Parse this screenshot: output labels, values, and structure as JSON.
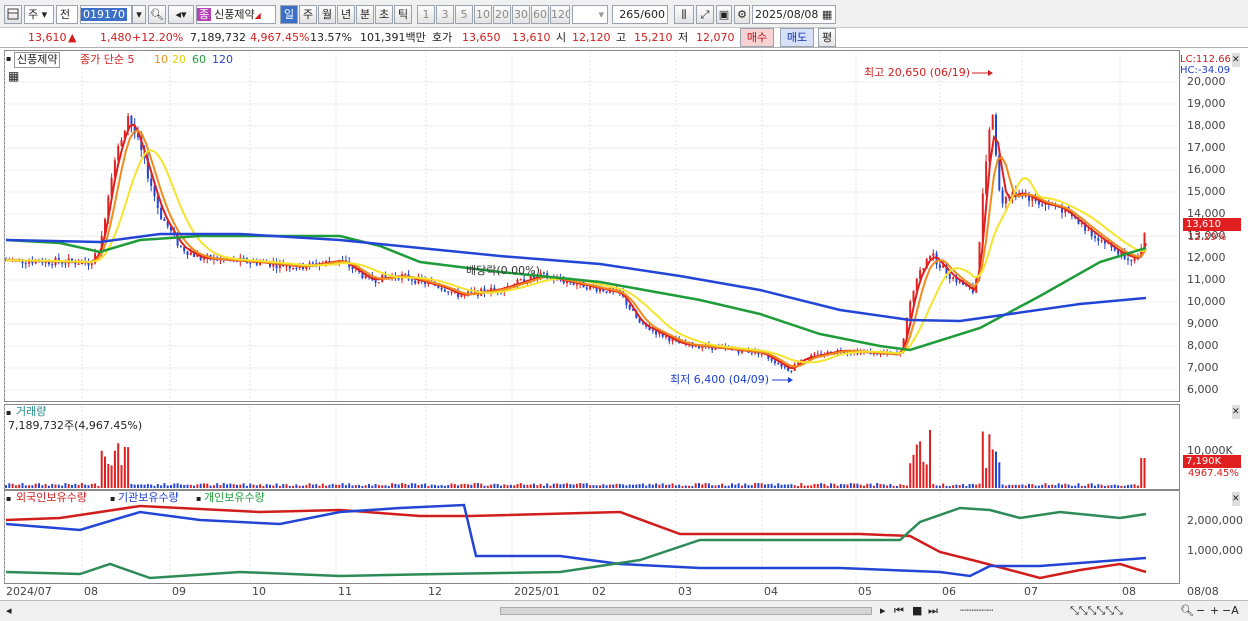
{
  "toolbar": {
    "market_label": "주",
    "period_label": "전",
    "code": "019170",
    "stock_badge": "종",
    "stock_name": "신풍제약",
    "periods": [
      "일",
      "주",
      "월",
      "년",
      "분",
      "초",
      "틱"
    ],
    "intervals": [
      "1",
      "3",
      "5",
      "10",
      "20",
      "30",
      "60",
      "120"
    ],
    "count": "265",
    "count_max": "/600",
    "date": "2025/08/08"
  },
  "quote": {
    "price": "13,610",
    "change": "1,480",
    "change_pct": "+12.20%",
    "volume": "7,189,732",
    "volume_pct": "4,967.45%",
    "turnover_pct": "13.57%",
    "amount": "101,391백만",
    "hoga_label": "호가",
    "ask": "13,650",
    "bid": "13,610",
    "open_label": "시",
    "open": "12,120",
    "high_label": "고",
    "high": "15,210",
    "low_label": "저",
    "low": "12,070",
    "buy_label": "매수",
    "sell_label": "매도",
    "eval_label": "평"
  },
  "price_panel": {
    "stock_label": "신풍제약",
    "legend_title": "종가 단순 5",
    "ma_labels": [
      "10",
      "20",
      "60",
      "120"
    ],
    "ma_colors": {
      "ma5": "#e02020",
      "ma10": "#f08c1c",
      "ma20": "#f5e42e",
      "ma60": "#1f9c3a",
      "ma120": "#2345d6"
    },
    "lc": "LC:112.66",
    "hc": "HC:-34.09",
    "high_note": "최고 20,650 (06/19)",
    "low_note": "최저 6,400 (04/09)",
    "dividend_note": "배당락(0.00%)",
    "y_ticks": [
      "20,000",
      "19,000",
      "18,000",
      "17,000",
      "16,000",
      "15,000",
      "14,000",
      "13,000",
      "12,000",
      "11,000",
      "10,000",
      "9,000",
      "8,000",
      "7,000",
      "6,000"
    ],
    "current_price": "13,610",
    "current_pct": "12.29%"
  },
  "volume_panel": {
    "title": "거래량",
    "value": "7,189,732주(4,967.45%)",
    "y_tick": "10,000K",
    "current": "7,190K",
    "current_pct": "4967.45%"
  },
  "holding_panel": {
    "legend": [
      "외국인보유수량",
      "기관보유수량",
      "개인보유수량"
    ],
    "y_ticks": [
      "2,000,000",
      "1,000,000"
    ]
  },
  "x_axis": {
    "labels": [
      "2024/07",
      "08",
      "09",
      "10",
      "11",
      "12",
      "2025/01",
      "02",
      "03",
      "04",
      "05",
      "06",
      "07",
      "08",
      "08/08"
    ]
  },
  "colors": {
    "up": "#e02020",
    "down": "#2345d6",
    "accent": "#3c6fc6"
  }
}
